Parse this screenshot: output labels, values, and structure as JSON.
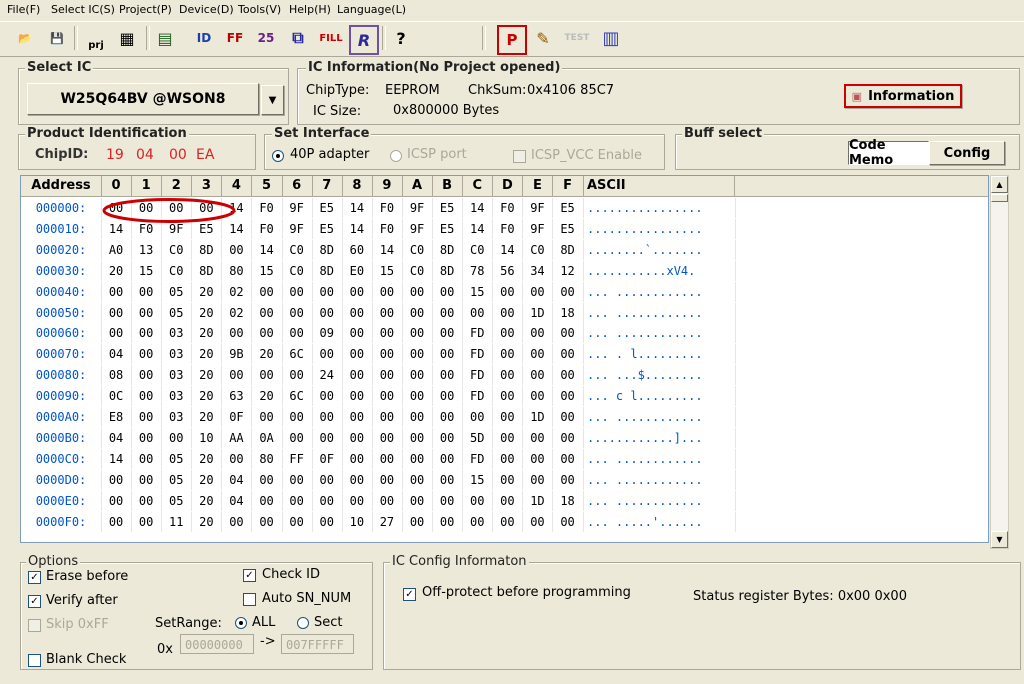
{
  "menu": [
    "File(F)",
    "Select IC(S)",
    "Project(P)",
    "Device(D)",
    "Tools(V)",
    "Help(H)",
    "Language(L)"
  ],
  "toolbar": {
    "open": "📂",
    "save": "💾",
    "prj": "prj",
    "project_save": "▦",
    "chip": "▤",
    "id": "ID",
    "ff": "FF",
    "checksum": "25",
    "verify": "⧉",
    "fill": "FILL",
    "read": "R",
    "help": "?",
    "program": "P",
    "edit": "✎",
    "test": "TEST",
    "chipconf": "▥"
  },
  "select_ic": {
    "title": "Select IC",
    "chip": "W25Q64BV @WSON8"
  },
  "ic_info": {
    "title": "IC Information(No Project opened)",
    "chiptype_label": "ChipType:",
    "chiptype": "EEPROM",
    "chksum_label": "ChkSum:",
    "chksum": "0x4106 85C7",
    "size_label": "IC Size:",
    "size": "0x800000 Bytes",
    "info_button": "Information"
  },
  "product_id": {
    "title": "Product Identification",
    "label": "ChipID:",
    "id": [
      "19",
      "04",
      "00",
      "EA"
    ]
  },
  "set_interface": {
    "title": "Set Interface",
    "opt1": "40P adapter",
    "opt2": "ICSP port",
    "opt3": "ICSP_VCC Enable"
  },
  "buff_select": {
    "title": "Buff select",
    "code": "Code Memo",
    "config": "Config"
  },
  "grid": {
    "columns": [
      "Address",
      "0",
      "1",
      "2",
      "3",
      "4",
      "5",
      "6",
      "7",
      "8",
      "9",
      "A",
      "B",
      "C",
      "D",
      "E",
      "F",
      "ASCII"
    ],
    "rows": [
      {
        "addr": "000000:",
        "bytes": [
          "00",
          "00",
          "00",
          "00",
          "14",
          "F0",
          "9F",
          "E5",
          "14",
          "F0",
          "9F",
          "E5",
          "14",
          "F0",
          "9F",
          "E5"
        ],
        "ascii": "................"
      },
      {
        "addr": "000010:",
        "bytes": [
          "14",
          "F0",
          "9F",
          "E5",
          "14",
          "F0",
          "9F",
          "E5",
          "14",
          "F0",
          "9F",
          "E5",
          "14",
          "F0",
          "9F",
          "E5"
        ],
        "ascii": "................"
      },
      {
        "addr": "000020:",
        "bytes": [
          "A0",
          "13",
          "C0",
          "8D",
          "00",
          "14",
          "C0",
          "8D",
          "60",
          "14",
          "C0",
          "8D",
          "C0",
          "14",
          "C0",
          "8D"
        ],
        "ascii": "........`......."
      },
      {
        "addr": "000030:",
        "bytes": [
          "20",
          "15",
          "C0",
          "8D",
          "80",
          "15",
          "C0",
          "8D",
          "E0",
          "15",
          "C0",
          "8D",
          "78",
          "56",
          "34",
          "12"
        ],
        "ascii": " ...........xV4."
      },
      {
        "addr": "000040:",
        "bytes": [
          "00",
          "00",
          "05",
          "20",
          "02",
          "00",
          "00",
          "00",
          "00",
          "00",
          "00",
          "00",
          "15",
          "00",
          "00",
          "00"
        ],
        "ascii": "... ............"
      },
      {
        "addr": "000050:",
        "bytes": [
          "00",
          "00",
          "05",
          "20",
          "02",
          "00",
          "00",
          "00",
          "00",
          "00",
          "00",
          "00",
          "00",
          "00",
          "1D",
          "18"
        ],
        "ascii": "... ............"
      },
      {
        "addr": "000060:",
        "bytes": [
          "00",
          "00",
          "03",
          "20",
          "00",
          "00",
          "00",
          "09",
          "00",
          "00",
          "00",
          "00",
          "FD",
          "00",
          "00",
          "00"
        ],
        "ascii": "... ............"
      },
      {
        "addr": "000070:",
        "bytes": [
          "04",
          "00",
          "03",
          "20",
          "9B",
          "20",
          "6C",
          "00",
          "00",
          "00",
          "00",
          "00",
          "FD",
          "00",
          "00",
          "00"
        ],
        "ascii": "... . l........."
      },
      {
        "addr": "000080:",
        "bytes": [
          "08",
          "00",
          "03",
          "20",
          "00",
          "00",
          "00",
          "24",
          "00",
          "00",
          "00",
          "00",
          "FD",
          "00",
          "00",
          "00"
        ],
        "ascii": "... ...$........"
      },
      {
        "addr": "000090:",
        "bytes": [
          "0C",
          "00",
          "03",
          "20",
          "63",
          "20",
          "6C",
          "00",
          "00",
          "00",
          "00",
          "00",
          "FD",
          "00",
          "00",
          "00"
        ],
        "ascii": "... c l........."
      },
      {
        "addr": "0000A0:",
        "bytes": [
          "E8",
          "00",
          "03",
          "20",
          "0F",
          "00",
          "00",
          "00",
          "00",
          "00",
          "00",
          "00",
          "00",
          "00",
          "1D",
          "00"
        ],
        "ascii": "... ............"
      },
      {
        "addr": "0000B0:",
        "bytes": [
          "04",
          "00",
          "00",
          "10",
          "AA",
          "0A",
          "00",
          "00",
          "00",
          "00",
          "00",
          "00",
          "5D",
          "00",
          "00",
          "00"
        ],
        "ascii": "............]..."
      },
      {
        "addr": "0000C0:",
        "bytes": [
          "14",
          "00",
          "05",
          "20",
          "00",
          "80",
          "FF",
          "0F",
          "00",
          "00",
          "00",
          "00",
          "FD",
          "00",
          "00",
          "00"
        ],
        "ascii": "... ............"
      },
      {
        "addr": "0000D0:",
        "bytes": [
          "00",
          "00",
          "05",
          "20",
          "04",
          "00",
          "00",
          "00",
          "00",
          "00",
          "00",
          "00",
          "15",
          "00",
          "00",
          "00"
        ],
        "ascii": "... ............"
      },
      {
        "addr": "0000E0:",
        "bytes": [
          "00",
          "00",
          "05",
          "20",
          "04",
          "00",
          "00",
          "00",
          "00",
          "00",
          "00",
          "00",
          "00",
          "00",
          "1D",
          "18"
        ],
        "ascii": "... ............"
      },
      {
        "addr": "0000F0:",
        "bytes": [
          "00",
          "00",
          "11",
          "20",
          "00",
          "00",
          "00",
          "00",
          "10",
          "27",
          "00",
          "00",
          "00",
          "00",
          "00",
          "00"
        ],
        "ascii": "... .....'......"
      }
    ]
  },
  "options": {
    "title": "Options",
    "erase": "Erase before",
    "verify": "Verify after",
    "skip": "Skip 0xFF",
    "blank": "Blank Check",
    "checkid": "Check ID",
    "autosn": "Auto SN_NUM",
    "setrange": "SetRange:",
    "all": "ALL",
    "sect": "Sect",
    "prefix": "0x",
    "from": "00000000",
    "arrow": "->",
    "to": "007FFFFF"
  },
  "ic_config": {
    "title": "IC Config Informaton",
    "offprotect": "Off-protect before programming",
    "status": "Status register Bytes: 0x00 0x00"
  },
  "colors": {
    "accent": "#cc0000",
    "chipid": "#dd2222",
    "addr": "#0055cc"
  }
}
